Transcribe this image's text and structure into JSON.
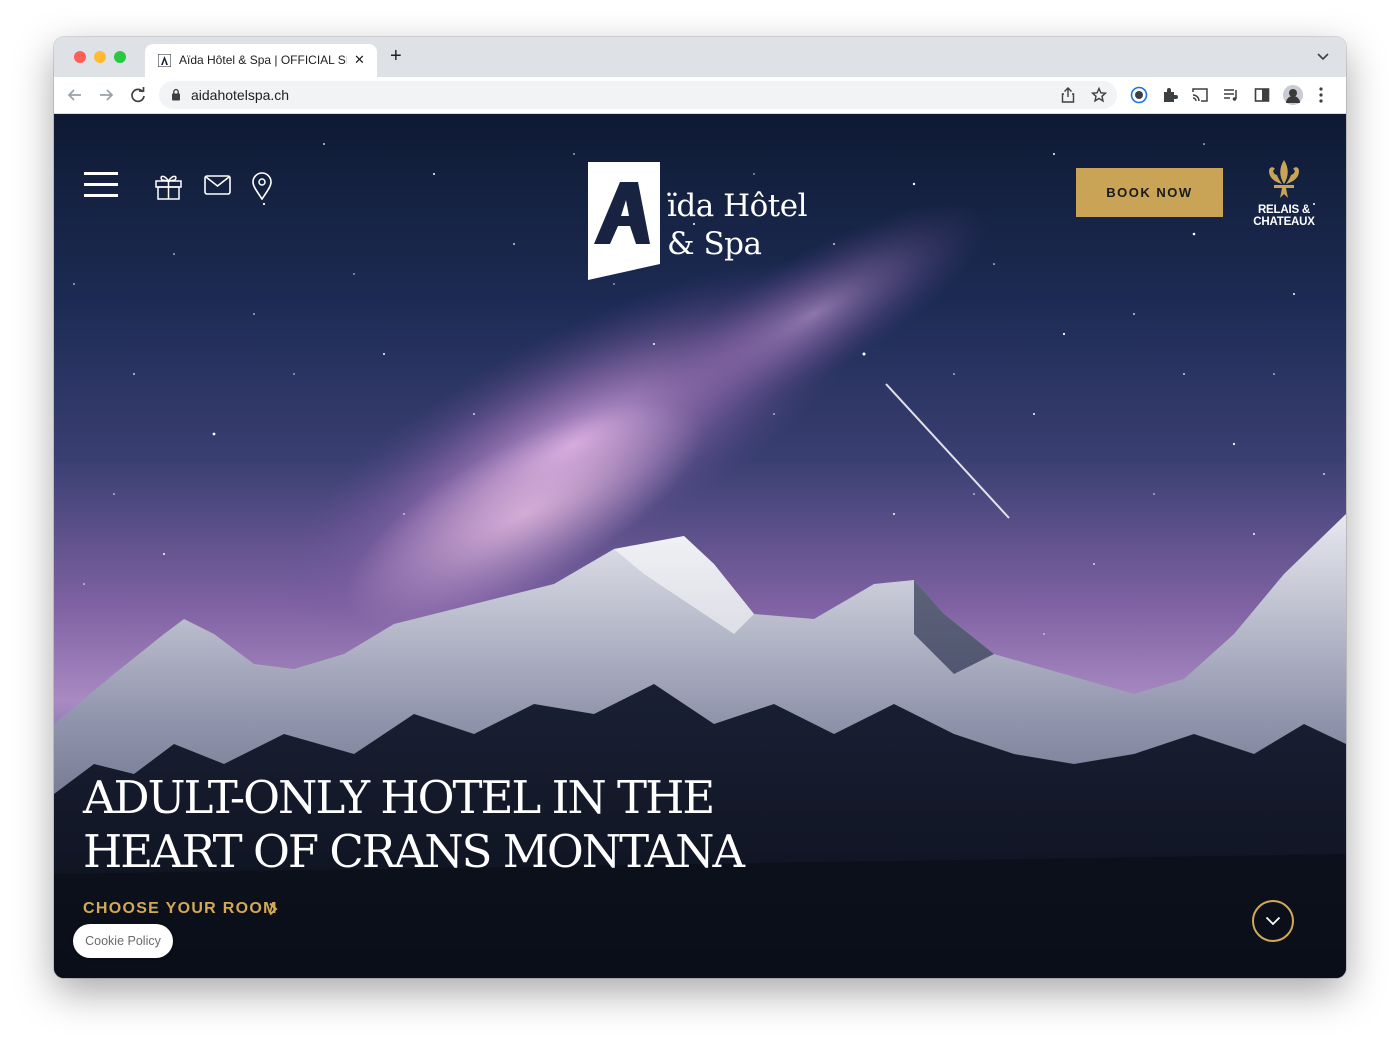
{
  "browser": {
    "tab_title": "Aïda Hôtel & Spa | OFFICIAL SITE",
    "tab_close": "✕",
    "new_tab": "+",
    "url": "aidahotelspa.ch"
  },
  "header": {
    "menu_icon": "hamburger-menu-icon",
    "icons": [
      "gift-icon",
      "mail-icon",
      "location-pin-icon"
    ],
    "logo_line1": "ïda Hôtel",
    "logo_line2": "& Spa",
    "book_now": "BOOK NOW",
    "partner_logo": "RELAIS & CHATEAUX"
  },
  "hero": {
    "headline": "ADULT-ONLY HOTEL IN THE HEART OF CRANS MONTANA",
    "cta": "CHOOSE YOUR ROOM",
    "scroll_icon": "chevron-down-icon"
  },
  "cookie_button": "Cookie Policy",
  "colors": {
    "accent_gold": "#c9a456",
    "hero_sky_top": "#0e1a33",
    "hero_milky_way": "#a98ac2",
    "tabbar_bg": "#dee1e6"
  }
}
